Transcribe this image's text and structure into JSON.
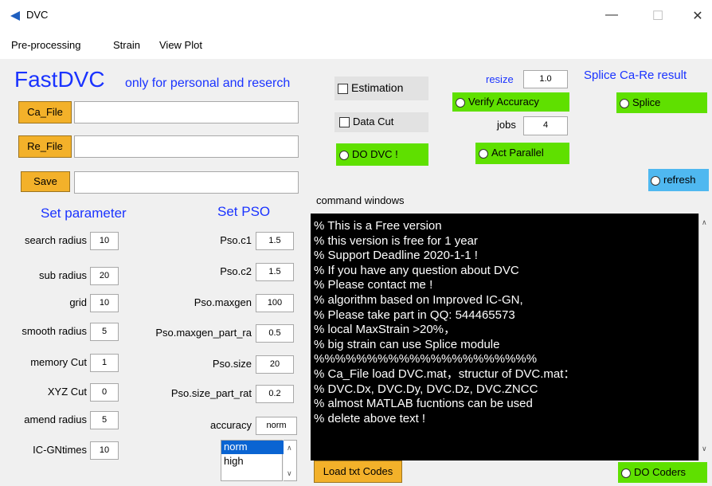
{
  "window": {
    "title": "DVC",
    "minimize": "—",
    "maximize": "☐",
    "close": "✕"
  },
  "menu": [
    "Pre-processing",
    "Strain",
    "View Plot"
  ],
  "header": {
    "title": "FastDVC",
    "subtitle": "only for personal and reserch"
  },
  "files": {
    "ca": "Ca_File",
    "re": "Re_File",
    "save": "Save"
  },
  "params": {
    "heading": "Set parameter",
    "items": [
      {
        "label": "search radius",
        "value": "10"
      },
      {
        "label": "sub radius",
        "value": "20"
      },
      {
        "label": "grid",
        "value": "10"
      },
      {
        "label": "smooth radius",
        "value": "5"
      },
      {
        "label": "memory Cut",
        "value": "1"
      },
      {
        "label": "XYZ Cut",
        "value": "0"
      },
      {
        "label": "amend radius",
        "value": "5"
      },
      {
        "label": "IC-GNtimes",
        "value": "10"
      }
    ]
  },
  "pso": {
    "heading": "Set PSO",
    "items": [
      {
        "label": "Pso.c1",
        "value": "1.5"
      },
      {
        "label": "Pso.c2",
        "value": "1.5"
      },
      {
        "label": "Pso.maxgen",
        "value": "100"
      },
      {
        "label": "Pso.maxgen_part_ra",
        "value": "0.5"
      },
      {
        "label": "Pso.size",
        "value": "20"
      },
      {
        "label": "Pso.size_part_rat",
        "value": "0.2"
      },
      {
        "label": "accuracy",
        "value": "norm"
      }
    ],
    "options": [
      "norm",
      "high"
    ]
  },
  "controls": {
    "estimation": "Estimation",
    "data_cut": "Data Cut",
    "do_dvc": "DO DVC !",
    "resize_label": "resize",
    "resize_value": "1.0",
    "verify": "Verify Accuracy",
    "jobs_label": "jobs",
    "jobs_value": "4",
    "act_parallel": "Act Parallel",
    "splice_title": "Splice Ca-Re result",
    "splice": "Splice",
    "refresh": "refresh"
  },
  "command": {
    "label": "command windows",
    "lines": [
      "% This is a Free version",
      "% this version is free for 1 year",
      "% Support Deadline 2020-1-1 !",
      "% If you have any question about DVC",
      "% Please contact me !",
      "% algorithm based on Improved IC-GN,",
      "% Please take part in QQ: 544465573",
      "% local MaxStrain >20%，",
      "% big strain can use Splice module",
      "%%%%%%%%%%%%%%%%%%%%%",
      "% Ca_File load DVC.mat，structur of DVC.mat：",
      "% DVC.Dx, DVC.Dy, DVC.Dz, DVC.ZNCC",
      "% almost MATLAB fucntions can be used",
      "% delete above text !"
    ],
    "load_button": "Load txt Codes",
    "do_coders": "DO Coders"
  }
}
